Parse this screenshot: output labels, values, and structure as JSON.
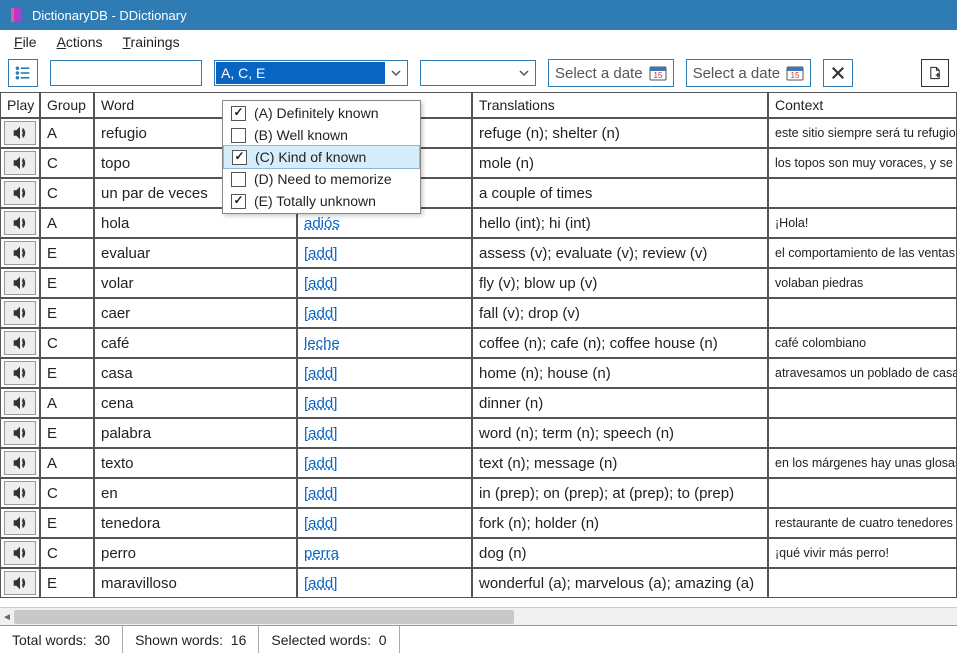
{
  "title": "DictionaryDB - DDictionary",
  "menu": {
    "file": "File",
    "actions": "Actions",
    "trainings": "Trainings"
  },
  "toolbar": {
    "group_filter_value": "A, C, E",
    "date1_label": "Select a date",
    "date2_label": "Select a date"
  },
  "columns": {
    "play": "Play",
    "group": "Group",
    "word": "Word",
    "translations": "Translations",
    "context": "Context"
  },
  "group_options": [
    {
      "label": "(A) Definitely known",
      "checked": true
    },
    {
      "label": "(B) Well known",
      "checked": false
    },
    {
      "label": "(C) Kind of known",
      "checked": true,
      "hover": true
    },
    {
      "label": "(D) Need to memorize",
      "checked": false
    },
    {
      "label": "(E) Totally unknown",
      "checked": true
    }
  ],
  "rows": [
    {
      "group": "A",
      "word": "refugio",
      "ant": "",
      "trans": "refuge (n); shelter (n)",
      "ctx": "este sitio siempre será tu refugio"
    },
    {
      "group": "C",
      "word": "topo",
      "ant": "",
      "trans": "mole (n)",
      "ctx": "los topos son muy voraces, y se alim"
    },
    {
      "group": "C",
      "word": "un par de veces",
      "ant": "",
      "trans": "a couple of times",
      "ctx": ""
    },
    {
      "group": "A",
      "word": "hola",
      "ant": "adiós",
      "trans": "hello (int); hi (int)",
      "ctx": "¡Hola!"
    },
    {
      "group": "E",
      "word": "evaluar",
      "ant": "[add]",
      "trans": "assess (v); evaluate (v); review (v)",
      "ctx": "el comportamiento de las ventas pe"
    },
    {
      "group": "E",
      "word": "volar",
      "ant": "[add]",
      "trans": "fly (v); blow up (v)",
      "ctx": "volaban piedras"
    },
    {
      "group": "E",
      "word": "caer",
      "ant": "[add]",
      "trans": "fall (v); drop (v)",
      "ctx": ""
    },
    {
      "group": "C",
      "word": "café",
      "ant": "leche",
      "trans": "coffee (n); cafe (n); coffee house (n)",
      "ctx": "café colombiano"
    },
    {
      "group": "E",
      "word": "casa",
      "ant": "[add]",
      "trans": "home (n); house (n)",
      "ctx": "atravesamos un poblado de casas e"
    },
    {
      "group": "A",
      "word": "cena",
      "ant": "[add]",
      "trans": "dinner (n)",
      "ctx": ""
    },
    {
      "group": "E",
      "word": "palabra",
      "ant": "[add]",
      "trans": "word (n); term (n); speech (n)",
      "ctx": ""
    },
    {
      "group": "A",
      "word": "texto",
      "ant": "[add]",
      "trans": "text (n); message (n)",
      "ctx": "en los márgenes hay unas glosas pa"
    },
    {
      "group": "C",
      "word": "en",
      "ant": "[add]",
      "trans": "in (prep); on (prep); at (prep); to (prep)",
      "ctx": ""
    },
    {
      "group": "E",
      "word": "tenedora",
      "ant": "[add]",
      "trans": "fork (n); holder (n)",
      "ctx": "restaurante de cuatro tenedores"
    },
    {
      "group": "C",
      "word": "perro",
      "ant": "perra",
      "trans": "dog (n)",
      "ctx": "¡qué vivir más perro!"
    },
    {
      "group": "E",
      "word": "maravilloso",
      "ant": "[add]",
      "trans": "wonderful (a); marvelous (a); amazing (a)",
      "ctx": ""
    }
  ],
  "status": {
    "total_label": "Total words:",
    "total_value": "30",
    "shown_label": "Shown words:",
    "shown_value": "16",
    "selected_label": "Selected words:",
    "selected_value": "0"
  }
}
